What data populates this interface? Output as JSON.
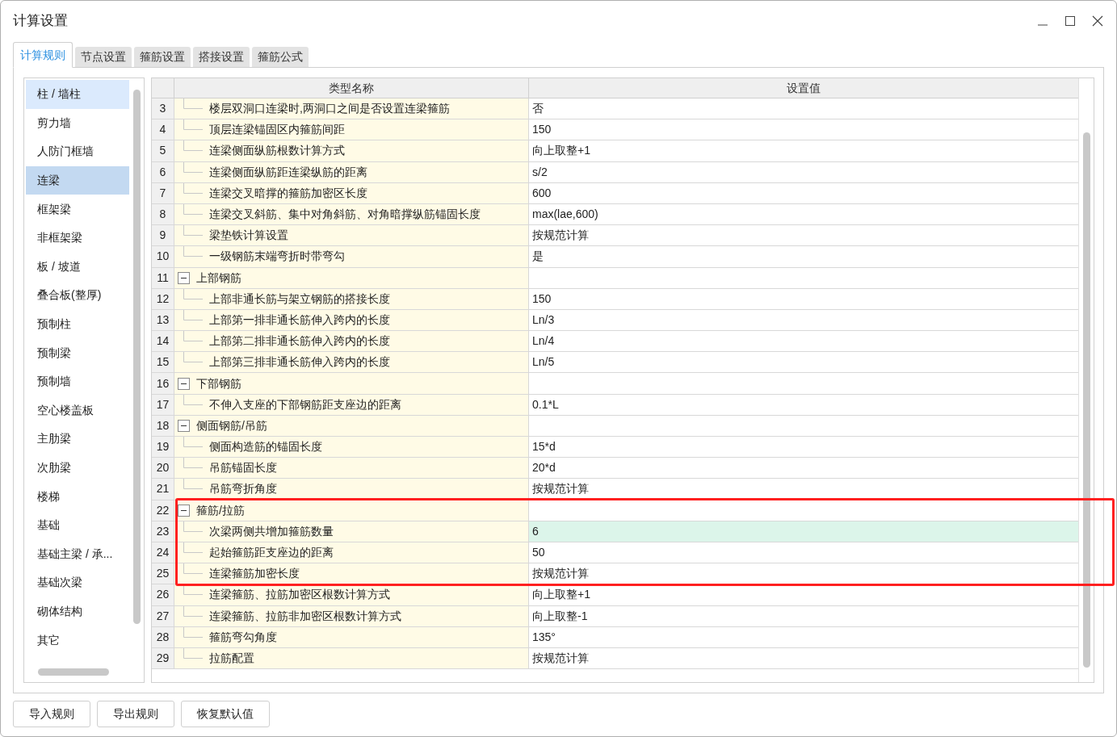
{
  "window": {
    "title": "计算设置"
  },
  "tabs": [
    {
      "label": "计算规则",
      "selected": true
    },
    {
      "label": "节点设置",
      "selected": false
    },
    {
      "label": "箍筋设置",
      "selected": false
    },
    {
      "label": "搭接设置",
      "selected": false
    },
    {
      "label": "箍筋公式",
      "selected": false
    }
  ],
  "sidebar": {
    "items": [
      {
        "label": "柱 / 墙柱",
        "selected": false,
        "hovered": true
      },
      {
        "label": "剪力墙",
        "selected": false,
        "hovered": false
      },
      {
        "label": "人防门框墙",
        "selected": false,
        "hovered": false
      },
      {
        "label": "连梁",
        "selected": true,
        "hovered": false
      },
      {
        "label": "框架梁",
        "selected": false,
        "hovered": false
      },
      {
        "label": "非框架梁",
        "selected": false,
        "hovered": false
      },
      {
        "label": "板 / 坡道",
        "selected": false,
        "hovered": false
      },
      {
        "label": "叠合板(整厚)",
        "selected": false,
        "hovered": false
      },
      {
        "label": "预制柱",
        "selected": false,
        "hovered": false
      },
      {
        "label": "预制梁",
        "selected": false,
        "hovered": false
      },
      {
        "label": "预制墙",
        "selected": false,
        "hovered": false
      },
      {
        "label": "空心楼盖板",
        "selected": false,
        "hovered": false
      },
      {
        "label": "主肋梁",
        "selected": false,
        "hovered": false
      },
      {
        "label": "次肋梁",
        "selected": false,
        "hovered": false
      },
      {
        "label": "楼梯",
        "selected": false,
        "hovered": false
      },
      {
        "label": "基础",
        "selected": false,
        "hovered": false
      },
      {
        "label": "基础主梁 / 承...",
        "selected": false,
        "hovered": false
      },
      {
        "label": "基础次梁",
        "selected": false,
        "hovered": false
      },
      {
        "label": "砌体结构",
        "selected": false,
        "hovered": false
      },
      {
        "label": "其它",
        "selected": false,
        "hovered": false
      }
    ]
  },
  "table": {
    "columns": [
      "类型名称",
      "设置值"
    ],
    "rows": [
      {
        "num": "3",
        "kind": "item",
        "name": "楼层双洞口连梁时,两洞口之间是否设置连梁箍筋",
        "value": "否",
        "selected": false
      },
      {
        "num": "4",
        "kind": "item",
        "name": "顶层连梁锚固区内箍筋间距",
        "value": "150",
        "selected": false
      },
      {
        "num": "5",
        "kind": "item",
        "name": "连梁侧面纵筋根数计算方式",
        "value": "向上取整+1",
        "selected": false
      },
      {
        "num": "6",
        "kind": "item",
        "name": "连梁侧面纵筋距连梁纵筋的距离",
        "value": "s/2",
        "selected": false
      },
      {
        "num": "7",
        "kind": "item",
        "name": "连梁交叉暗撑的箍筋加密区长度",
        "value": "600",
        "selected": false
      },
      {
        "num": "8",
        "kind": "item",
        "name": "连梁交叉斜筋、集中对角斜筋、对角暗撑纵筋锚固长度",
        "value": "max(lae,600)",
        "selected": false
      },
      {
        "num": "9",
        "kind": "item",
        "name": "梁垫铁计算设置",
        "value": "按规范计算",
        "selected": false
      },
      {
        "num": "10",
        "kind": "item",
        "name": "一级钢筋末端弯折时带弯勾",
        "value": "是",
        "selected": false
      },
      {
        "num": "11",
        "kind": "group",
        "name": "上部钢筋",
        "expanded": true,
        "selected": false
      },
      {
        "num": "12",
        "kind": "item",
        "name": "上部非通长筋与架立钢筋的搭接长度",
        "value": "150",
        "selected": false
      },
      {
        "num": "13",
        "kind": "item",
        "name": "上部第一排非通长筋伸入跨内的长度",
        "value": "Ln/3",
        "selected": false
      },
      {
        "num": "14",
        "kind": "item",
        "name": "上部第二排非通长筋伸入跨内的长度",
        "value": "Ln/4",
        "selected": false
      },
      {
        "num": "15",
        "kind": "item",
        "name": "上部第三排非通长筋伸入跨内的长度",
        "value": "Ln/5",
        "selected": false
      },
      {
        "num": "16",
        "kind": "group",
        "name": "下部钢筋",
        "expanded": true,
        "selected": false
      },
      {
        "num": "17",
        "kind": "item",
        "name": "不伸入支座的下部钢筋距支座边的距离",
        "value": "0.1*L",
        "selected": false
      },
      {
        "num": "18",
        "kind": "group",
        "name": "侧面钢筋/吊筋",
        "expanded": true,
        "selected": false
      },
      {
        "num": "19",
        "kind": "item",
        "name": "侧面构造筋的锚固长度",
        "value": "15*d",
        "selected": false
      },
      {
        "num": "20",
        "kind": "item",
        "name": "吊筋锚固长度",
        "value": "20*d",
        "selected": false
      },
      {
        "num": "21",
        "kind": "item",
        "name": "吊筋弯折角度",
        "value": "按规范计算",
        "selected": false
      },
      {
        "num": "22",
        "kind": "group",
        "name": "箍筋/拉筋",
        "expanded": true,
        "selected": false
      },
      {
        "num": "23",
        "kind": "item",
        "name": "次梁两侧共增加箍筋数量",
        "value": "6",
        "selected": true
      },
      {
        "num": "24",
        "kind": "item",
        "name": "起始箍筋距支座边的距离",
        "value": "50",
        "selected": false
      },
      {
        "num": "25",
        "kind": "item",
        "name": "连梁箍筋加密长度",
        "value": "按规范计算",
        "selected": false
      },
      {
        "num": "26",
        "kind": "item",
        "name": "连梁箍筋、拉筋加密区根数计算方式",
        "value": "向上取整+1",
        "selected": false
      },
      {
        "num": "27",
        "kind": "item",
        "name": "连梁箍筋、拉筋非加密区根数计算方式",
        "value": "向上取整-1",
        "selected": false
      },
      {
        "num": "28",
        "kind": "item",
        "name": "箍筋弯勾角度",
        "value": "135°",
        "selected": false
      },
      {
        "num": "29",
        "kind": "item",
        "name": "拉筋配置",
        "value": "按规范计算",
        "selected": false
      }
    ]
  },
  "annotation": {
    "kind": "highlight-box",
    "color": "#ff2020"
  },
  "buttons": [
    "导入规则",
    "导出规则",
    "恢复默认值"
  ]
}
